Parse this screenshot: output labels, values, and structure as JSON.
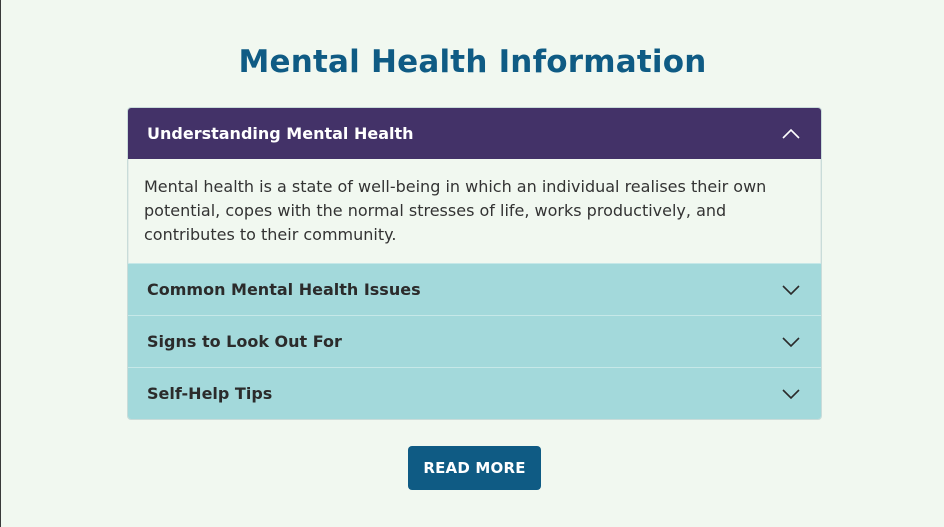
{
  "page": {
    "title": "Mental Health Information"
  },
  "accordion": {
    "items": [
      {
        "label": "Understanding Mental Health",
        "expanded": true,
        "content": "Mental health is a state of well-being in which an individual realises their own potential, copes with the normal stresses of life, works productively, and contributes to their community.",
        "icon": "chevron-up-icon"
      },
      {
        "label": "Common Mental Health Issues",
        "expanded": false,
        "icon": "chevron-down-icon"
      },
      {
        "label": "Signs to Look Out For",
        "expanded": false,
        "icon": "chevron-down-icon"
      },
      {
        "label": "Self-Help Tips",
        "expanded": false,
        "icon": "chevron-down-icon"
      }
    ]
  },
  "actions": {
    "read_more_label": "READ MORE"
  },
  "colors": {
    "background": "#f1f8f0",
    "title": "#0f5b84",
    "active_header": "#433268",
    "inactive_header": "#a3d9db",
    "button": "#0f5b84"
  }
}
